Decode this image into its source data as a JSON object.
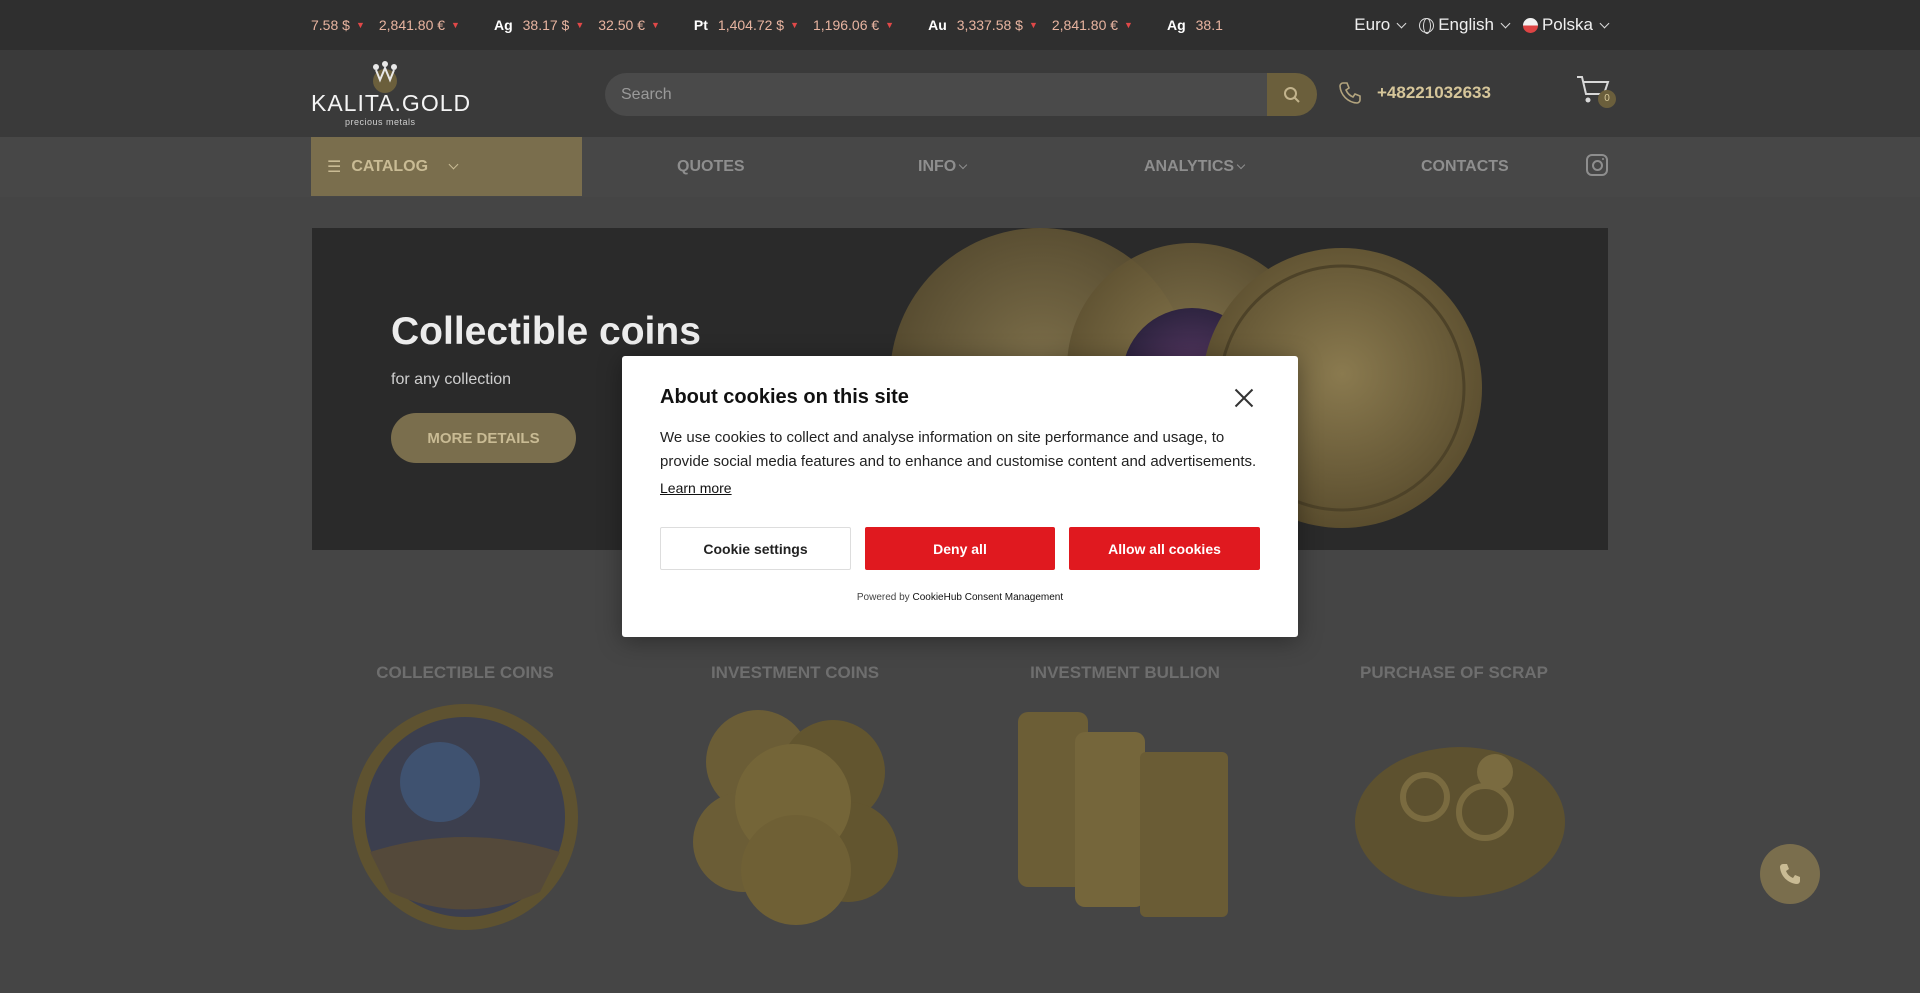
{
  "ticker": {
    "items": [
      {
        "metal": "",
        "usd": "7.58 $",
        "eur": "2,841.80 €"
      },
      {
        "metal": "Ag",
        "usd": "38.17 $",
        "eur": "32.50 €"
      },
      {
        "metal": "Pt",
        "usd": "1,404.72 $",
        "eur": "1,196.06 €"
      },
      {
        "metal": "Au",
        "usd": "3,337.58 $",
        "eur": "2,841.80 €"
      },
      {
        "metal": "Ag",
        "usd": "38.1",
        "eur": ""
      }
    ],
    "currency": "Euro",
    "language": "English",
    "country": "Polska"
  },
  "header": {
    "logo_text": "KALITA.GOLD",
    "logo_sub": "precious metals",
    "search_placeholder": "Search",
    "phone": "+48221032633",
    "cart_count": "0"
  },
  "nav": {
    "catalog": "CATALOG",
    "items": [
      "QUOTES",
      "INFO",
      "ANALYTICS",
      "CONTACTS"
    ]
  },
  "hero": {
    "title": "Collectible coins",
    "subtitle": "for any collection",
    "button": "MORE DETAILS"
  },
  "categories": [
    "COLLECTIBLE COINS",
    "INVESTMENT COINS",
    "INVESTMENT BULLION",
    "PURCHASE OF SCRAP"
  ],
  "cookie_dialog": {
    "title": "About cookies on this site",
    "text": "We use cookies to collect and analyse information on site performance and usage, to provide social media features and to enhance and customise content and advertisements.",
    "learn_more": "Learn more",
    "settings_btn": "Cookie settings",
    "deny_btn": "Deny all",
    "allow_btn": "Allow all cookies",
    "powered_prefix": "Powered by",
    "powered_link": "CookieHub Consent Management"
  },
  "colors": {
    "accent_red": "#e0191f",
    "gold_dimmed": "#7a6e4d"
  }
}
